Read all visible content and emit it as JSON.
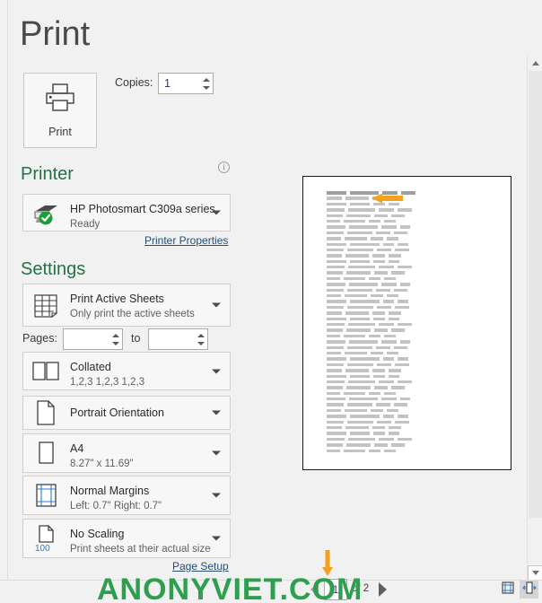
{
  "page_title": "Print",
  "print_button": {
    "label": "Print",
    "icon": "printer-icon"
  },
  "copies": {
    "label": "Copies:",
    "value": "1"
  },
  "printer": {
    "heading": "Printer",
    "info_icon": "info-icon",
    "name": "HP Photosmart C309a series",
    "status": "Ready",
    "status_icon": "green-check-icon",
    "properties_link": "Printer Properties"
  },
  "settings": {
    "heading": "Settings",
    "items": [
      {
        "icon": "sheets-grid-icon",
        "title": "Print Active Sheets",
        "subtitle": "Only print the active sheets"
      },
      {
        "icon": "collated-icon",
        "title": "Collated",
        "subtitle": "1,2,3   1,2,3   1,2,3"
      },
      {
        "icon": "portrait-page-icon",
        "title": "Portrait Orientation",
        "subtitle": ""
      },
      {
        "icon": "paper-size-icon",
        "title": "A4",
        "subtitle": "8.27\" x 11.69\""
      },
      {
        "icon": "margins-icon",
        "title": "Normal Margins",
        "subtitle": "Left:  0.7\"   Right:  0.7\""
      },
      {
        "icon": "scaling-100-icon",
        "title": "No Scaling",
        "subtitle": "Print sheets at their actual size"
      }
    ],
    "pages": {
      "label": "Pages:",
      "from": "",
      "to_label": "to",
      "to": ""
    },
    "page_setup_link": "Page Setup"
  },
  "preview": {
    "columns": [
      "Last Name",
      "Sales",
      "Country",
      "Quarter"
    ],
    "annotation_arrow_left": "orange-arrow-left",
    "annotation_arrow_down": "orange-arrow-down",
    "accent_color": "#f5a01e"
  },
  "statusbar": {
    "prev_icon": "triangle-left-icon",
    "next_icon": "triangle-right-icon",
    "page_number": "1",
    "of_text": "of 2",
    "show_margins_icon": "show-margins-icon",
    "zoom_to_page_icon": "zoom-to-page-icon"
  },
  "watermark": {
    "text": "ANONYVIET.COM",
    "color": "#2e9e4f"
  },
  "scrollbar": {
    "up_icon": "scroll-up-icon",
    "down_icon": "scroll-down-icon"
  }
}
